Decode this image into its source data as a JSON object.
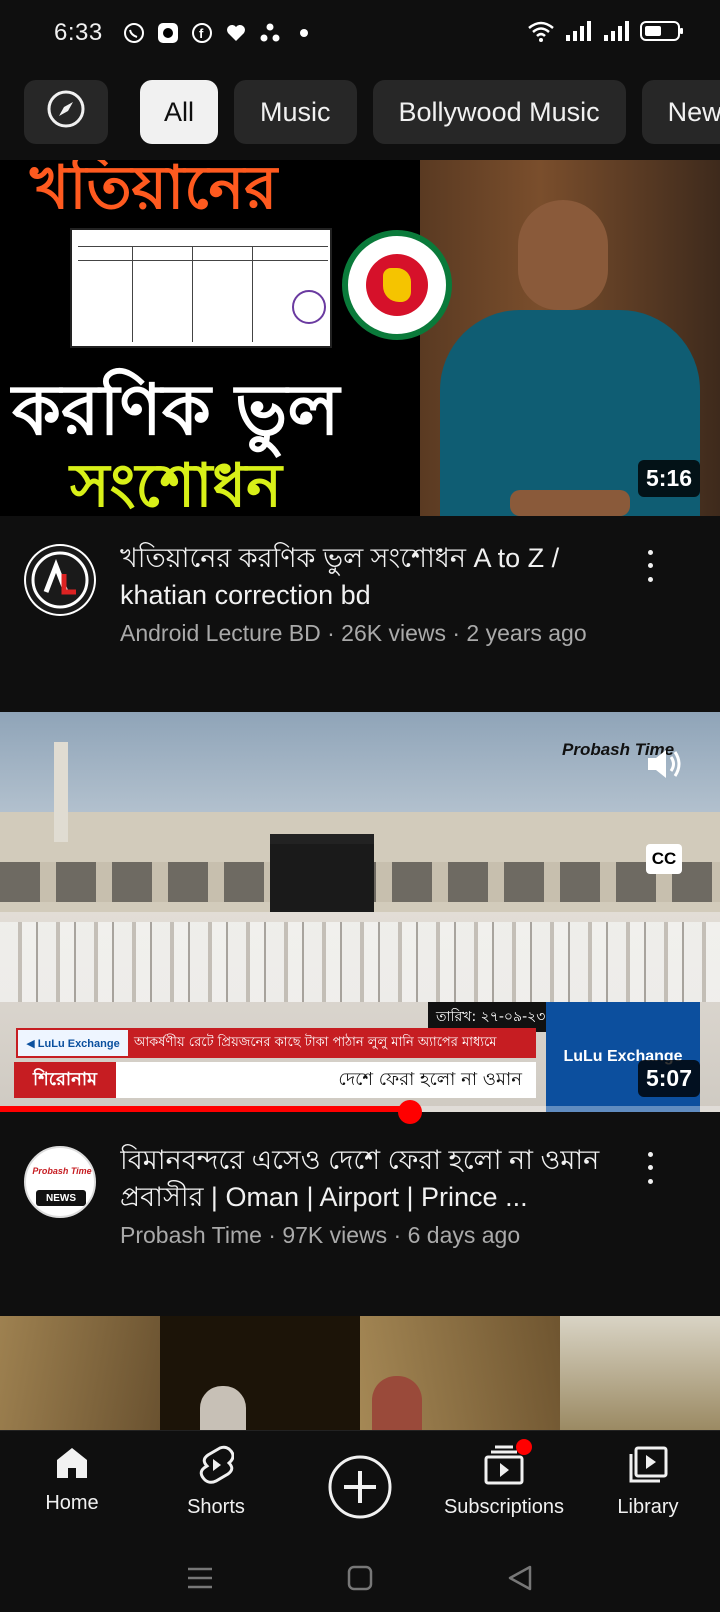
{
  "status": {
    "time": "6:33"
  },
  "chips": [
    {
      "icon": "compass-icon"
    },
    {
      "label": "All",
      "active": true
    },
    {
      "label": "Music"
    },
    {
      "label": "Bollywood Music"
    },
    {
      "label": "New"
    }
  ],
  "videos": [
    {
      "thumb_text_1": "খতিয়ানের",
      "thumb_text_2": "করণিক ভুল",
      "thumb_text_3": "সংশোধন",
      "duration": "5:16",
      "title": "খতিয়ানের করণিক ভুল সংশোধন A to Z / khatian correction bd",
      "channel_meta": "Android Lecture BD · 26K views · 2 years ago"
    },
    {
      "watermark": "Probash Time",
      "date_label": "তারিখ: ২৭-০৯-২৩",
      "ticker": "আকর্ষণীয় রেটে প্রিয়জনের কাছে টাকা পাঠান লুলু মানি অ্যাপের মাধ্যমে",
      "headline_tag": "শিরোনাম",
      "headline": "দেশে ফেরা হলো না ওমান",
      "sponsor": "LuLu Exchange",
      "cc_label": "CC",
      "duration": "5:07",
      "progress": 0.57,
      "title": "বিমানবন্দরে এসেও দেশে ফেরা হলো না ওমান প্রবাসীর | Oman | Airport | Prince ...",
      "channel_meta": "Probash Time · 97K views · 6 days ago",
      "avatar_text_1": "Probash Time",
      "avatar_text_2": "NEWS"
    }
  ],
  "nav": {
    "home": "Home",
    "shorts": "Shorts",
    "subscriptions": "Subscriptions",
    "library": "Library"
  },
  "colors": {
    "accent": "#ff0000",
    "background": "#0f0f0f",
    "chip": "#272727"
  }
}
